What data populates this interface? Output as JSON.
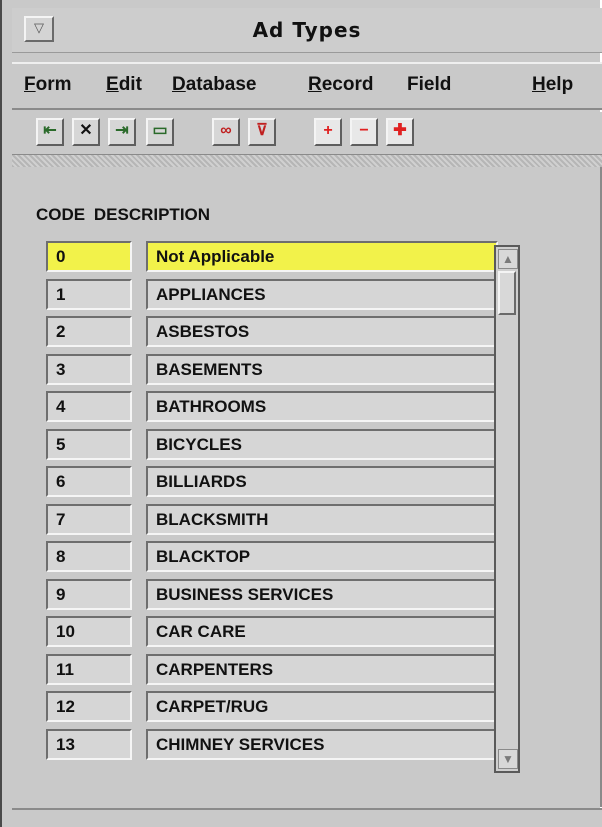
{
  "window": {
    "title": "Ad Types",
    "sysmenu_glyph": "▽"
  },
  "menubar": [
    {
      "label": "Form",
      "mnemonic": "F"
    },
    {
      "label": "Edit",
      "mnemonic": "E"
    },
    {
      "label": "Database",
      "mnemonic": "D"
    },
    {
      "label": "Record",
      "mnemonic": "R"
    },
    {
      "label": "Field",
      "mnemonic": ""
    },
    {
      "label": "Help",
      "mnemonic": "H"
    }
  ],
  "toolbar": [
    {
      "icon": "exit-form-icon",
      "glyph": "⇤"
    },
    {
      "icon": "delete-x-icon",
      "glyph": "✕"
    },
    {
      "icon": "enter-query-icon",
      "glyph": "⇥"
    },
    {
      "icon": "screen-icon",
      "glyph": "▭"
    },
    {
      "icon": "glasses-view-icon",
      "glyph": "∞"
    },
    {
      "icon": "query-filter-icon",
      "glyph": "⊽"
    },
    {
      "icon": "add-record-icon",
      "glyph": "+"
    },
    {
      "icon": "remove-record-icon",
      "glyph": "−"
    },
    {
      "icon": "duplicate-record-icon",
      "glyph": "✚"
    }
  ],
  "columns": {
    "code": "CODE",
    "description": "DESCRIPTION"
  },
  "rows": [
    {
      "code": "0",
      "description": "Not Applicable",
      "selected": true
    },
    {
      "code": "1",
      "description": "APPLIANCES"
    },
    {
      "code": "2",
      "description": "ASBESTOS"
    },
    {
      "code": "3",
      "description": "BASEMENTS"
    },
    {
      "code": "4",
      "description": "BATHROOMS"
    },
    {
      "code": "5",
      "description": "BICYCLES"
    },
    {
      "code": "6",
      "description": "BILLIARDS"
    },
    {
      "code": "7",
      "description": "BLACKSMITH"
    },
    {
      "code": "8",
      "description": "BLACKTOP"
    },
    {
      "code": "9",
      "description": "BUSINESS SERVICES"
    },
    {
      "code": "10",
      "description": "CAR CARE"
    },
    {
      "code": "11",
      "description": "CARPENTERS"
    },
    {
      "code": "12",
      "description": "CARPET/RUG"
    },
    {
      "code": "13",
      "description": "CHIMNEY SERVICES"
    }
  ],
  "colors": {
    "selected_row": "#f2f24a",
    "window_bg": "#c9c9c9",
    "cell_bg": "#d6d6d6",
    "add_red": "#e02020"
  }
}
